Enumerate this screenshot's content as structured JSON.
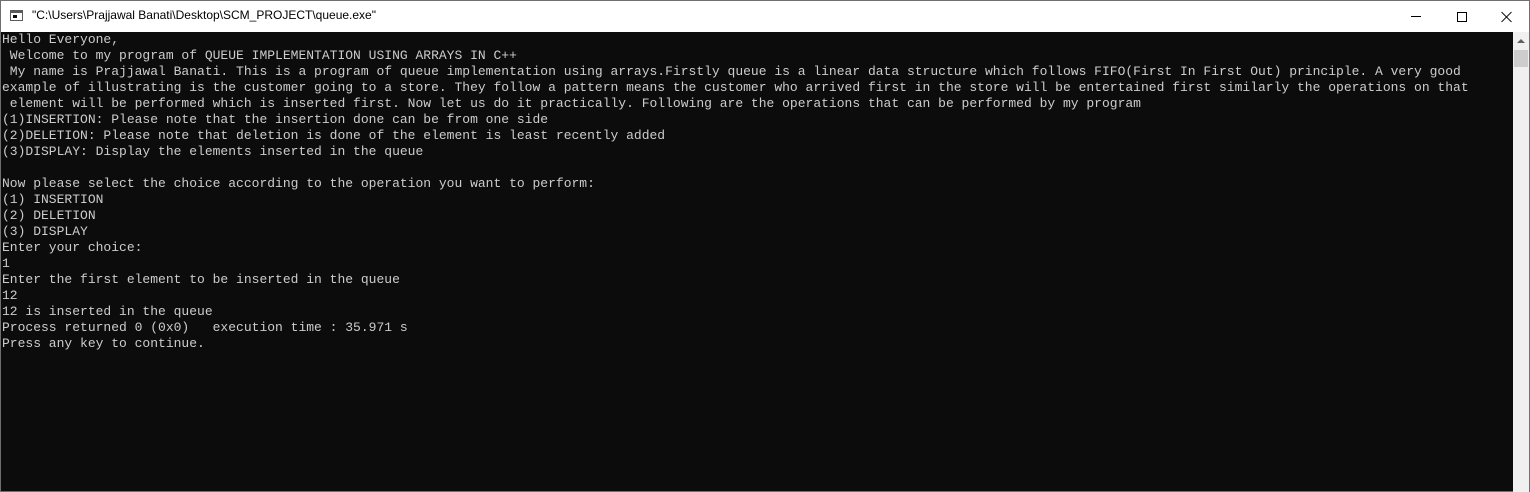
{
  "window": {
    "title": "\"C:\\Users\\Prajjawal Banati\\Desktop\\SCM_PROJECT\\queue.exe\""
  },
  "console": {
    "lines": [
      "Hello Everyone,",
      " Welcome to my program of QUEUE IMPLEMENTATION USING ARRAYS IN C++",
      " My name is Prajjawal Banati. This is a program of queue implementation using arrays.Firstly queue is a linear data structure which follows FIFO(First In First Out) principle. A very good",
      "example of illustrating is the customer going to a store. They follow a pattern means the customer who arrived first in the store will be entertained first similarly the operations on that",
      " element will be performed which is inserted first. Now let us do it practically. Following are the operations that can be performed by my program",
      "(1)INSERTION: Please note that the insertion done can be from one side",
      "(2)DELETION: Please note that deletion is done of the element is least recently added",
      "(3)DISPLAY: Display the elements inserted in the queue",
      "",
      "Now please select the choice according to the operation you want to perform:",
      "(1) INSERTION",
      "(2) DELETION",
      "(3) DISPLAY",
      "Enter your choice:",
      "1",
      "Enter the first element to be inserted in the queue",
      "12",
      "12 is inserted in the queue",
      "Process returned 0 (0x0)   execution time : 35.971 s",
      "Press any key to continue."
    ]
  },
  "colors": {
    "console_background": "#0c0c0c",
    "console_text": "#cccccc",
    "titlebar_background": "#ffffff"
  },
  "icons": {
    "app": "console-app-icon",
    "minimize": "minimize-icon",
    "maximize": "maximize-icon",
    "close": "close-icon",
    "scroll_up": "scroll-up-arrow-icon"
  }
}
